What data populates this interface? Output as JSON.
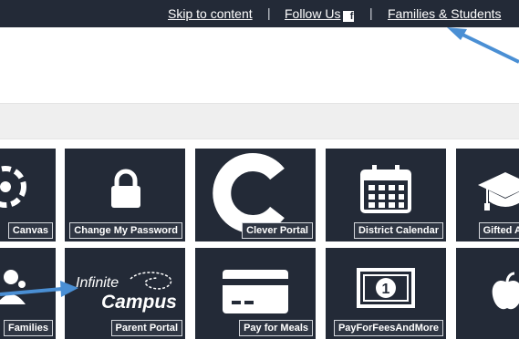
{
  "top_nav": {
    "skip_label": "Skip to content",
    "follow_label": "Follow Us",
    "families_label": "Families & Students",
    "separator": "|"
  },
  "tiles": {
    "canvas": "Canvas",
    "change_password": "Change My Password",
    "clever": "Clever Portal",
    "district_calendar": "District Calendar",
    "gifted": "Gifted A",
    "families": "Families",
    "parent_portal": "Parent Portal",
    "pay_meals": "Pay for Meals",
    "pay_fees": "PayForFeesAndMore"
  },
  "infinite_campus": {
    "line1": "Infinite",
    "line2": "Campus"
  },
  "colors": {
    "tile_bg": "#232a37",
    "arrow": "#4a8fd4"
  }
}
